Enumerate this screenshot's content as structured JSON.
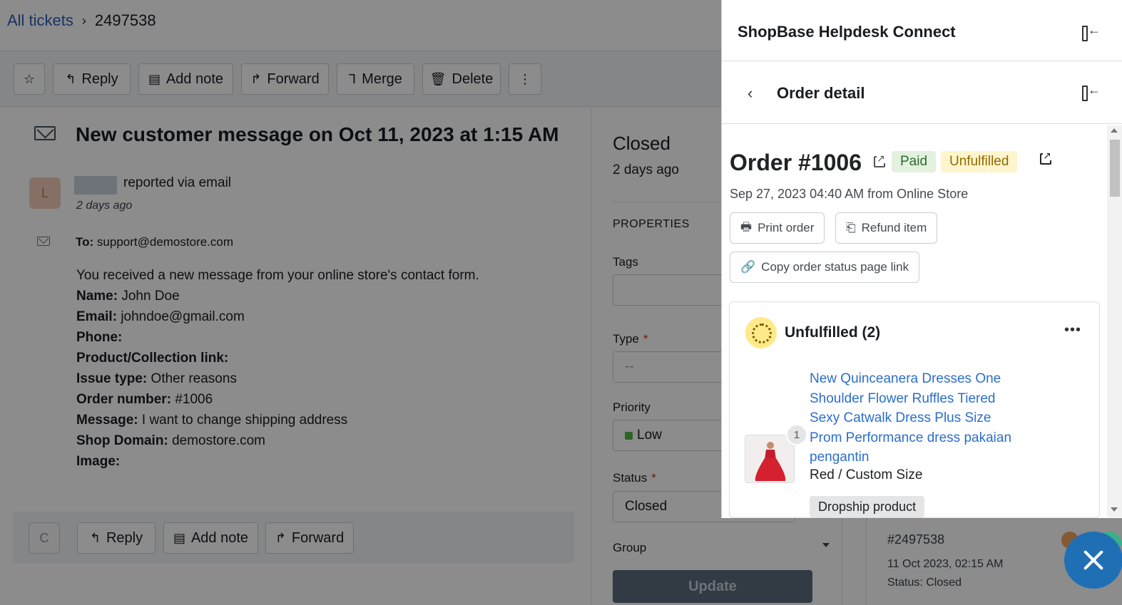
{
  "breadcrumb": {
    "all_tickets": "All tickets",
    "ticket_id": "2497538"
  },
  "toolbar": {
    "reply": "Reply",
    "add_note": "Add note",
    "forward": "Forward",
    "merge": "Merge",
    "delete": "Delete"
  },
  "ticket": {
    "title": "New customer message on Oct 11, 2023 at 1:15 AM",
    "avatar_letter": "L",
    "reported": "reported via email",
    "ago": "2 days ago",
    "to_label": "To:",
    "to_value": "support@demostore.com",
    "intro": "You received a new message from your online store's contact form.",
    "fields": [
      {
        "label": "Name:",
        "value": "John Doe"
      },
      {
        "label": "Email:",
        "value": "johndoe@gmail.com"
      },
      {
        "label": "Phone:",
        "value": ""
      },
      {
        "label": "Product/Collection link:",
        "value": ""
      },
      {
        "label": "Issue type:",
        "value": "Other reasons"
      },
      {
        "label": "Order number:",
        "value": "#1006"
      },
      {
        "label": "Message:",
        "value": "I want to change shipping address"
      },
      {
        "label": "Shop Domain:",
        "value": "demostore.com"
      },
      {
        "label": "Image:",
        "value": ""
      }
    ]
  },
  "reply_bar": {
    "avatar_letter": "C",
    "reply": "Reply",
    "add_note": "Add note",
    "forward": "Forward"
  },
  "properties": {
    "status_title": "Closed",
    "status_ago": "2 days ago",
    "heading": "PROPERTIES",
    "tags_label": "Tags",
    "type_label": "Type",
    "type_placeholder": "--",
    "priority_label": "Priority",
    "priority_value": "Low",
    "status_label": "Status",
    "status_value": "Closed",
    "group_label": "Group",
    "update": "Update",
    "required_mark": "*"
  },
  "activity": {
    "ticket_id": "#2497538",
    "date": "11 Oct 2023, 02:15 AM",
    "status": "Status: Closed"
  },
  "panel": {
    "title": "ShopBase Helpdesk Connect",
    "sub_title": "Order detail",
    "order_title": "Order #1006",
    "badge_paid": "Paid",
    "badge_unfulfilled": "Unfulfilled",
    "order_sub": "Sep 27, 2023 04:40 AM from Online Store",
    "print_order": "Print order",
    "refund_item": "Refund item",
    "copy_link": "Copy order status page link",
    "unfulfilled_title": "Unfulfilled (2)",
    "qty": "1",
    "product_name": "New Quinceanera Dresses One Shoulder Flower Ruffles Tiered Sexy Catwalk Dress Plus Size Prom Performance dress pakaian pengantin",
    "variant": "Red / Custom Size",
    "tag": "Dropship product"
  },
  "colors": {
    "link": "#2b5eb8",
    "paid_bg": "#e3f1df",
    "unfulfilled_bg": "#fff5cc",
    "fab": "#1f6fb5"
  }
}
